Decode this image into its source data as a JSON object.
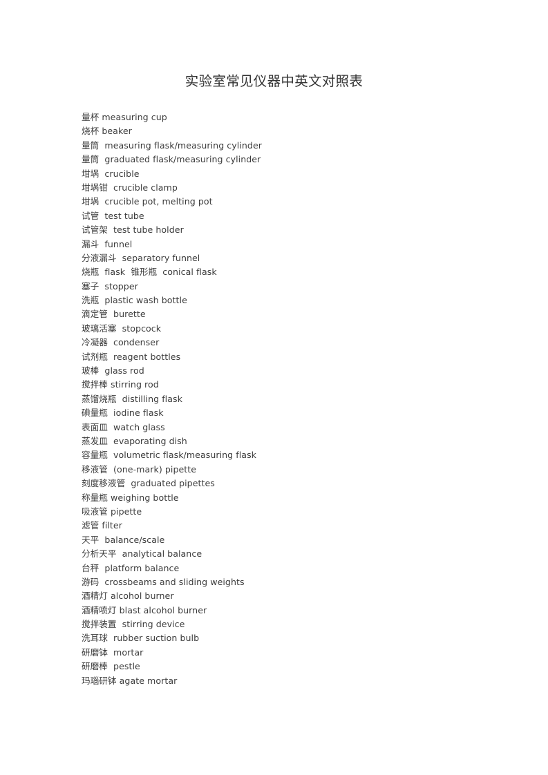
{
  "document": {
    "title": "实验室常见仪器中英文对照表",
    "background_color": "#ffffff",
    "text_color": "#3c3c3c",
    "entries": [
      {
        "cn": "量杯",
        "en": "measuring cup",
        "line": "量杯 measuring cup"
      },
      {
        "cn": "烧杯",
        "en": "beaker",
        "line": "烧杯 beaker"
      },
      {
        "cn": "量筒",
        "en": "measuring flask/measuring cylinder",
        "line": "量筒  measuring flask/measuring cylinder"
      },
      {
        "cn": "量筒",
        "en": "graduated flask/measuring cylinder",
        "line": "量筒  graduated flask/measuring cylinder"
      },
      {
        "cn": "坩埚",
        "en": "crucible",
        "line": "坩埚  crucible"
      },
      {
        "cn": "坩埚钳",
        "en": "crucible clamp",
        "line": "坩埚钳  crucible clamp"
      },
      {
        "cn": "坩埚",
        "en": "crucible pot, melting pot",
        "line": "坩埚  crucible pot, melting pot"
      },
      {
        "cn": "试管",
        "en": "test tube",
        "line": "试管  test tube"
      },
      {
        "cn": "试管架",
        "en": "test tube holder",
        "line": "试管架  test tube holder"
      },
      {
        "cn": "漏斗",
        "en": "funnel",
        "line": "漏斗  funnel"
      },
      {
        "cn": "分液漏斗",
        "en": "separatory funnel",
        "line": "分液漏斗  separatory funnel"
      },
      {
        "cn": "烧瓶 / 锥形瓶",
        "en": "flask / conical flask",
        "line": "烧瓶  flask  锥形瓶  conical flask"
      },
      {
        "cn": "塞子",
        "en": "stopper",
        "line": "塞子  stopper"
      },
      {
        "cn": "洗瓶",
        "en": "plastic wash bottle",
        "line": "洗瓶  plastic wash bottle"
      },
      {
        "cn": "滴定管",
        "en": "burette",
        "line": "滴定管  burette"
      },
      {
        "cn": "玻璃活塞",
        "en": "stopcock",
        "line": "玻璃活塞  stopcock"
      },
      {
        "cn": "冷凝器",
        "en": "condenser",
        "line": "冷凝器  condenser"
      },
      {
        "cn": "试剂瓶",
        "en": "reagent bottles",
        "line": "试剂瓶  reagent bottles"
      },
      {
        "cn": "玻棒",
        "en": "glass rod",
        "line": "玻棒  glass rod"
      },
      {
        "cn": "搅拌棒",
        "en": "stirring rod",
        "line": "搅拌棒 stirring rod"
      },
      {
        "cn": "蒸馏烧瓶",
        "en": "distilling flask",
        "line": "蒸馏烧瓶  distilling flask"
      },
      {
        "cn": "碘量瓶",
        "en": "iodine flask",
        "line": "碘量瓶  iodine flask"
      },
      {
        "cn": "表面皿",
        "en": "watch glass",
        "line": "表面皿  watch glass"
      },
      {
        "cn": "蒸发皿",
        "en": "evaporating dish",
        "line": "蒸发皿  evaporating dish"
      },
      {
        "cn": "容量瓶",
        "en": "volumetric flask/measuring flask",
        "line": "容量瓶  volumetric flask/measuring flask"
      },
      {
        "cn": "移液管",
        "en": "(one-mark) pipette",
        "line": "移液管  (one-mark) pipette"
      },
      {
        "cn": "刻度移液管",
        "en": "graduated pipettes",
        "line": "刻度移液管  graduated pipettes"
      },
      {
        "cn": "称量瓶",
        "en": "weighing bottle",
        "line": "称量瓶 weighing bottle"
      },
      {
        "cn": "吸液管",
        "en": "pipette",
        "line": "吸液管 pipette"
      },
      {
        "cn": "滤管",
        "en": "filter",
        "line": "滤管 filter"
      },
      {
        "cn": "天平",
        "en": "balance/scale",
        "line": "天平  balance/scale"
      },
      {
        "cn": "分析天平",
        "en": "analytical balance",
        "line": "分析天平  analytical balance"
      },
      {
        "cn": "台秤",
        "en": "platform balance",
        "line": "台秤  platform balance"
      },
      {
        "cn": "游码",
        "en": "crossbeams and sliding weights",
        "line": "游码  crossbeams and sliding weights"
      },
      {
        "cn": "酒精灯",
        "en": "alcohol burner",
        "line": "酒精灯 alcohol burner"
      },
      {
        "cn": "酒精喷灯",
        "en": "blast alcohol burner",
        "line": "酒精喷灯 blast alcohol burner"
      },
      {
        "cn": "搅拌装置",
        "en": "stirring device",
        "line": "搅拌装置  stirring device"
      },
      {
        "cn": "洗耳球",
        "en": "rubber suction bulb",
        "line": "洗耳球  rubber suction bulb"
      },
      {
        "cn": "研磨钵",
        "en": "mortar",
        "line": "研磨钵  mortar"
      },
      {
        "cn": "研磨棒",
        "en": "pestle",
        "line": "研磨棒  pestle"
      },
      {
        "cn": "玛瑙研钵",
        "en": "agate mortar",
        "line": "玛瑙研钵 agate mortar"
      }
    ]
  }
}
